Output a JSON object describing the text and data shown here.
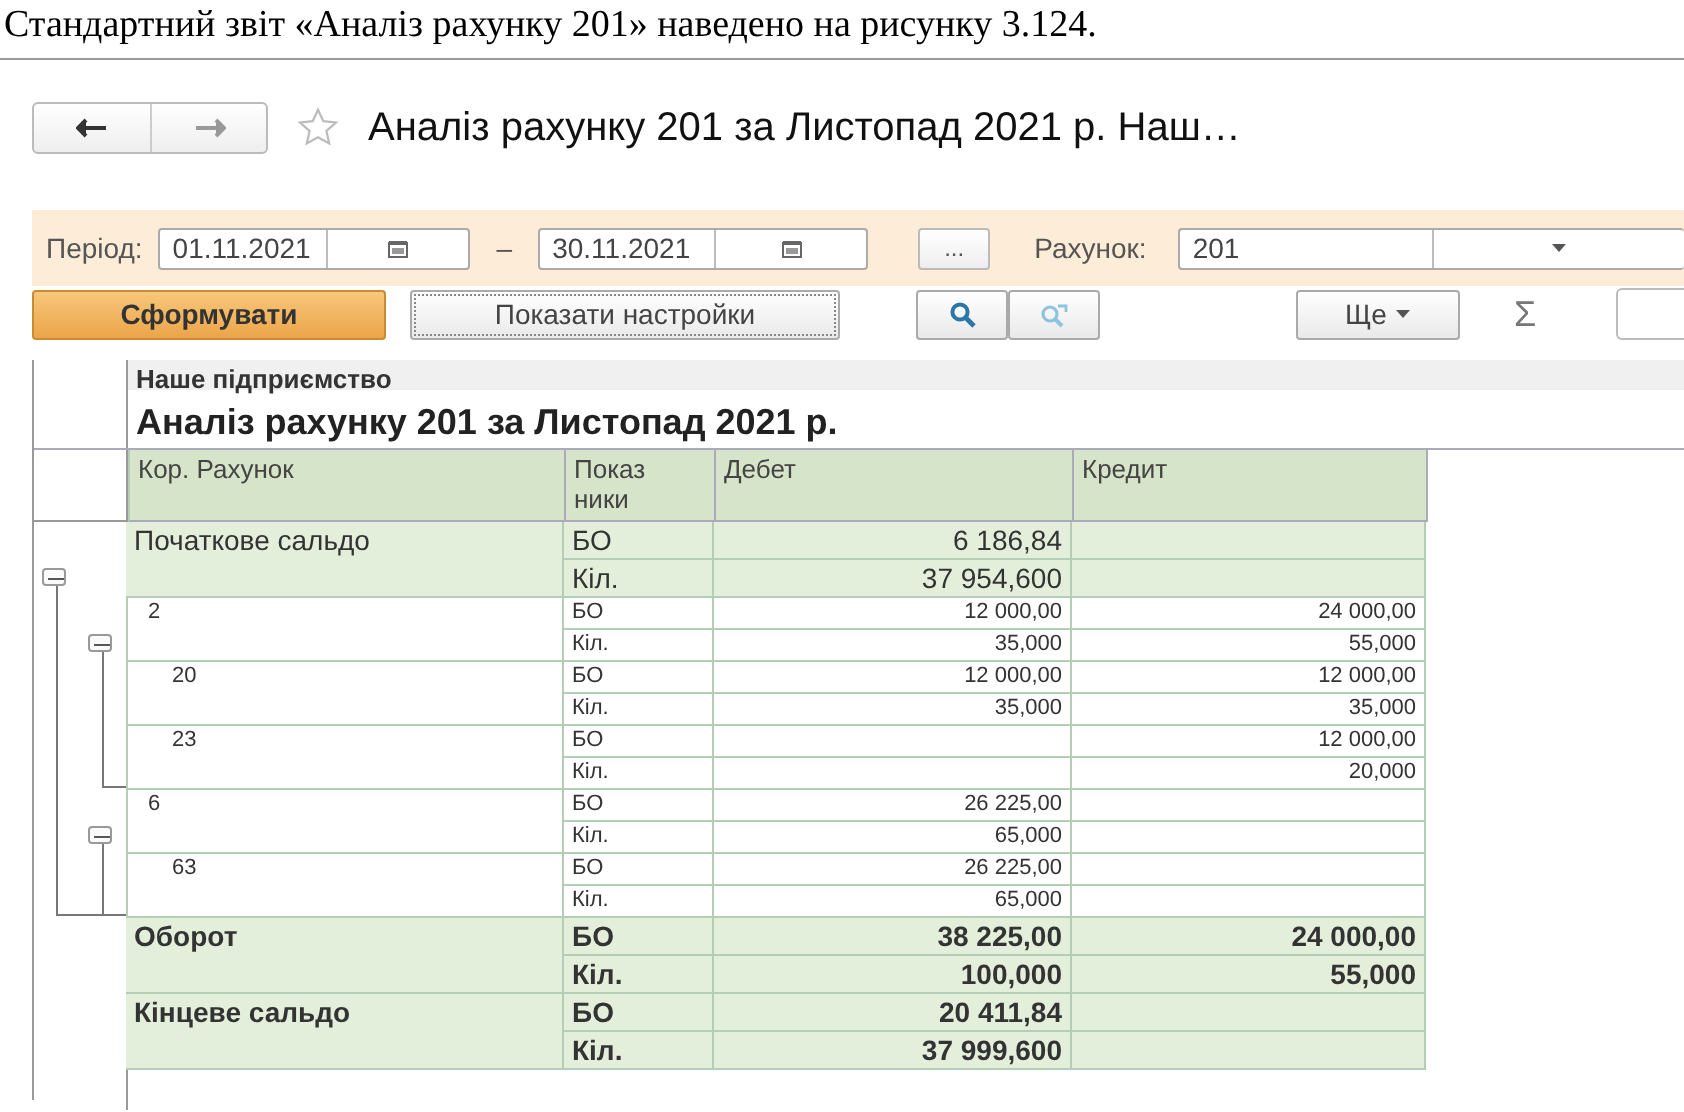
{
  "caption": "Стандартний звіт «Аналіз рахунку 201» наведено на рисунку 3.124.",
  "window": {
    "title": "Аналіз рахунку 201 за Листопад 2021 р. Наш…",
    "favorite": false
  },
  "filters": {
    "period_label": "Період:",
    "date_from": "01.11.2021",
    "separator": "–",
    "date_to": "30.11.2021",
    "more_button": "...",
    "account_label": "Рахунок:",
    "account": "201"
  },
  "commands": {
    "generate": "Сформувати",
    "show_settings": "Показати настройки",
    "more": "Ще",
    "sum": "Σ"
  },
  "report": {
    "company": "Наше підприємство",
    "title": "Аналіз рахунку 201 за Листопад 2021 р.",
    "columns": [
      "Кор. Рахунок",
      "Показ ники",
      "Дебет",
      "Кредит"
    ],
    "sections": [
      {
        "kind": "balance",
        "label": "Початкове сальдо",
        "lines": [
          {
            "indicator": "БО",
            "debit": "6 186,84"
          },
          {
            "indicator": "Кіл.",
            "debit": "37 954,600"
          }
        ]
      },
      {
        "kind": "group",
        "expanded": true,
        "children": [
          {
            "label": "2",
            "expanded": true,
            "lines": [
              {
                "indicator": "БО",
                "debit": "12 000,00",
                "credit": "24 000,00"
              },
              {
                "indicator": "Кіл.",
                "debit": "35,000",
                "credit": "55,000"
              }
            ],
            "children": [
              {
                "label": "20",
                "lines": [
                  {
                    "indicator": "БО",
                    "debit": "12 000,00",
                    "credit": "12 000,00"
                  },
                  {
                    "indicator": "Кіл.",
                    "debit": "35,000",
                    "credit": "35,000"
                  }
                ]
              },
              {
                "label": "23",
                "lines": [
                  {
                    "indicator": "БО",
                    "credit": "12 000,00"
                  },
                  {
                    "indicator": "Кіл.",
                    "credit": "20,000"
                  }
                ]
              }
            ]
          },
          {
            "label": "6",
            "expanded": true,
            "lines": [
              {
                "indicator": "БО",
                "debit": "26 225,00"
              },
              {
                "indicator": "Кіл.",
                "debit": "65,000"
              }
            ],
            "children": [
              {
                "label": "63",
                "lines": [
                  {
                    "indicator": "БО",
                    "debit": "26 225,00"
                  },
                  {
                    "indicator": "Кіл.",
                    "debit": "65,000"
                  }
                ]
              }
            ]
          }
        ]
      },
      {
        "kind": "total",
        "label": "Оборот",
        "lines": [
          {
            "indicator": "БО",
            "debit": "38 225,00",
            "credit": "24 000,00"
          },
          {
            "indicator": "Кіл.",
            "debit": "100,000",
            "credit": "55,000"
          }
        ]
      },
      {
        "kind": "total",
        "label": "Кінцеве сальдо",
        "lines": [
          {
            "indicator": "БО",
            "debit": "20 411,84"
          },
          {
            "indicator": "Кіл.",
            "debit": "37 999,600"
          }
        ]
      }
    ]
  }
}
